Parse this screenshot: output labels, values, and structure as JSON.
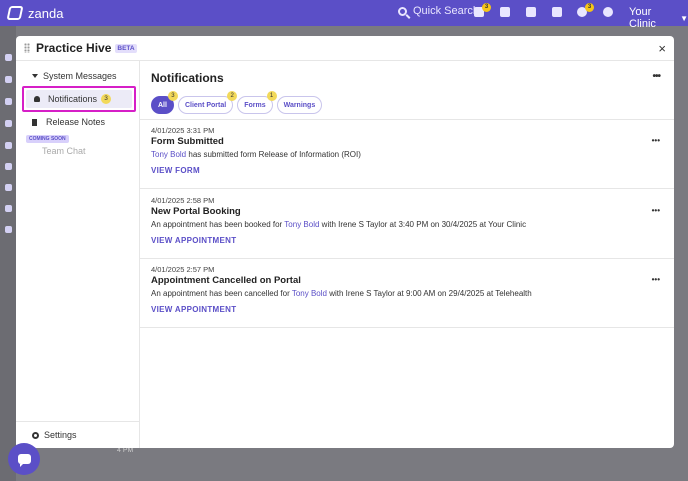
{
  "topbar": {
    "brand": "zanda",
    "search_label": "Quick Search",
    "clinic": "Your Clinic",
    "icons": [
      {
        "name": "bulletin-icon",
        "badge": "3"
      },
      {
        "name": "calendar-icon",
        "badge": ""
      },
      {
        "name": "clipboard-icon",
        "badge": ""
      },
      {
        "name": "wallet-icon",
        "badge": ""
      },
      {
        "name": "tasks-icon",
        "badge": "3"
      },
      {
        "name": "chat-icon",
        "badge": ""
      }
    ],
    "accent": "#5b4fc7"
  },
  "background": {
    "time_label": "4 PM"
  },
  "modal": {
    "title": "Practice Hive",
    "beta": "BETA",
    "close": "×"
  },
  "sidebar": {
    "section": "System Messages",
    "notifications": {
      "label": "Notifications",
      "badge": "3"
    },
    "release_notes": "Release Notes",
    "coming_soon": "COMING SOON",
    "team_chat": "Team Chat",
    "settings": "Settings"
  },
  "main": {
    "title": "Notifications",
    "more": "•••",
    "filters": [
      {
        "label": "All",
        "badge": "3",
        "active": true
      },
      {
        "label": "Client Portal",
        "badge": "2",
        "active": false
      },
      {
        "label": "Forms",
        "badge": "1",
        "active": false
      },
      {
        "label": "Warnings",
        "badge": "",
        "active": false
      }
    ],
    "items": [
      {
        "timestamp": "4/01/2025 3:31 PM",
        "title": "Form Submitted",
        "client": "Tony Bold",
        "body": " has submitted form Release of Information (ROI)",
        "action": "VIEW FORM",
        "more": "•••"
      },
      {
        "timestamp": "4/01/2025 2:58 PM",
        "title": "New Portal Booking",
        "body_pre": "An appointment has been booked for ",
        "client": "Tony Bold",
        "body_post": " with Irene S Taylor at 3:40 PM on 30/4/2025 at Your Clinic",
        "action": "VIEW APPOINTMENT",
        "more": "•••"
      },
      {
        "timestamp": "4/01/2025 2:57 PM",
        "title": "Appointment Cancelled on Portal",
        "body_pre": "An appointment has been cancelled for ",
        "client": "Tony Bold",
        "body_post": " with Irene S Taylor at 9:00 AM on 29/4/2025 at Telehealth",
        "action": "VIEW APPOINTMENT",
        "more": "•••"
      }
    ]
  }
}
